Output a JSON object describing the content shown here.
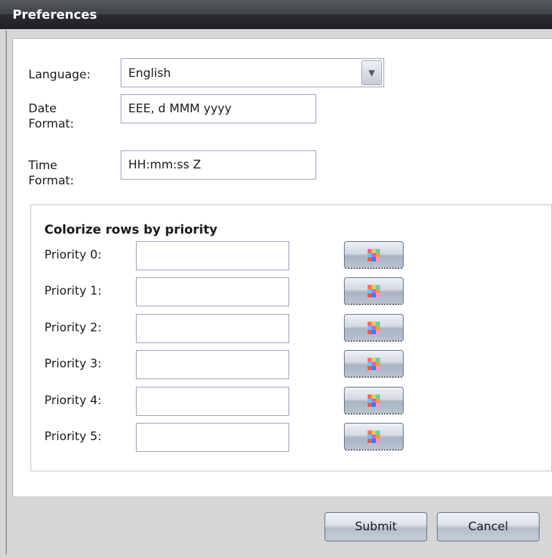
{
  "window": {
    "title": "Preferences"
  },
  "general": {
    "language_label": "Language:",
    "language_value": "English",
    "date_format_label_line1": "Date",
    "date_format_label_line2": "Format:",
    "date_format_value": "EEE, d MMM yyyy",
    "time_format_label_line1": "Time",
    "time_format_label_line2": "Format:",
    "time_format_value": "HH:mm:ss Z"
  },
  "priority_group": {
    "title": "Colorize rows by priority",
    "rows": [
      {
        "label": "Priority 0:",
        "value": ""
      },
      {
        "label": "Priority 1:",
        "value": ""
      },
      {
        "label": "Priority 2:",
        "value": ""
      },
      {
        "label": "Priority 3:",
        "value": ""
      },
      {
        "label": "Priority 4:",
        "value": ""
      },
      {
        "label": "Priority 5:",
        "value": ""
      }
    ],
    "picker_icon": "color-palette-icon",
    "palette_colors": [
      "#ff6b6b",
      "#f2c94c",
      "#6fcf97",
      "#56ccf2",
      "#bb6bd9",
      "#f2994a",
      "#eb5757",
      "#2f80ed",
      "#ff8fd8"
    ]
  },
  "footer": {
    "submit_label": "Submit",
    "cancel_label": "Cancel"
  }
}
